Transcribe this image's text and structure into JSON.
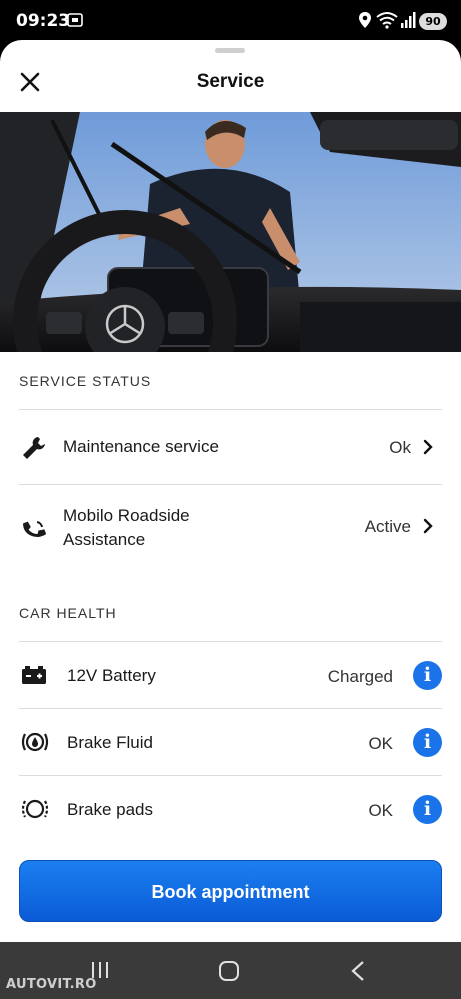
{
  "status_bar": {
    "time": "09:23",
    "battery": "90",
    "icons": [
      "screenshot-icon",
      "location-icon",
      "wifi-icon",
      "signal-icon"
    ]
  },
  "header": {
    "title": "Service"
  },
  "service_status": {
    "label": "SERVICE STATUS",
    "items": [
      {
        "label": "Maintenance service",
        "value": "Ok",
        "icon": "wrench-icon"
      },
      {
        "label": "Mobilo Roadside Assistance",
        "value": "Active",
        "icon": "roadside-phone-icon"
      }
    ]
  },
  "car_health": {
    "label": "CAR HEALTH",
    "items": [
      {
        "label": "12V Battery",
        "value": "Charged",
        "icon": "car-battery-icon"
      },
      {
        "label": "Brake Fluid",
        "value": "OK",
        "icon": "brake-fluid-icon"
      },
      {
        "label": "Brake pads",
        "value": "OK",
        "icon": "brake-pads-icon"
      }
    ]
  },
  "actions": {
    "book_label": "Book appointment"
  },
  "watermark": "AUTOVIT.RO",
  "colors": {
    "accent": "#1a73e8",
    "button": "#0b6be0"
  }
}
